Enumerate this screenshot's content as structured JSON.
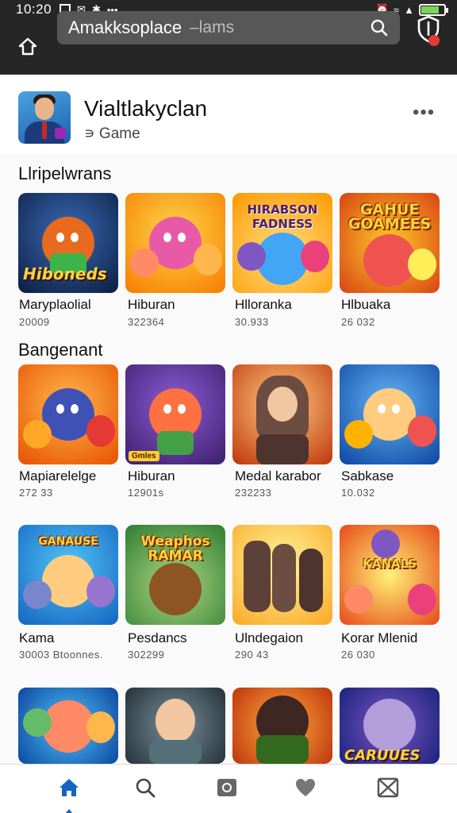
{
  "status": {
    "time": "10:20"
  },
  "appbar": {
    "search_query": "Amakksoplace",
    "search_hint": "–lams"
  },
  "header": {
    "title": "Vialtlakyclan",
    "subtitle": "Game"
  },
  "sections": [
    {
      "title": "Llripelwrans",
      "items": [
        {
          "label": "Maryplaolial",
          "count": "20009",
          "art": "Hiboneds"
        },
        {
          "label": "Hiburan",
          "count": "322364",
          "art": ""
        },
        {
          "label": "Hlloranka",
          "count": "30.933",
          "art": "HIRABSON FADNESS"
        },
        {
          "label": "Hlbuaka",
          "count": "26 032",
          "art": "GAHUE GOAMEES"
        }
      ]
    },
    {
      "title": "Bangenant",
      "items": [
        {
          "label": "Mapiarelelge",
          "count": "272 33",
          "art": ""
        },
        {
          "label": "Hiburan",
          "count": "12901s",
          "art": "Gmles"
        },
        {
          "label": "Medal karabor",
          "count": "232233",
          "art": ""
        },
        {
          "label": "Sabkase",
          "count": "10.032",
          "art": ""
        }
      ]
    },
    {
      "title": "",
      "items": [
        {
          "label": "Kama",
          "count": "30003 Btoonnes.",
          "art": "GANAUSE"
        },
        {
          "label": "Pesdancs",
          "count": "302299",
          "art": "Weaphos RAMAR"
        },
        {
          "label": "Ulndegaion",
          "count": "290 43",
          "art": ""
        },
        {
          "label": "Korar Mlenid",
          "count": "26 030",
          "art": "KANALS"
        }
      ]
    },
    {
      "title": "",
      "items": [
        {
          "label": "",
          "count": "",
          "art": ""
        },
        {
          "label": "",
          "count": "",
          "art": ""
        },
        {
          "label": "",
          "count": "",
          "art": ""
        },
        {
          "label": "",
          "count": "",
          "art": "CARUUES"
        }
      ]
    }
  ],
  "nav": [
    "home-icon",
    "search-icon",
    "library-icon",
    "heart-icon",
    "mail-icon"
  ]
}
